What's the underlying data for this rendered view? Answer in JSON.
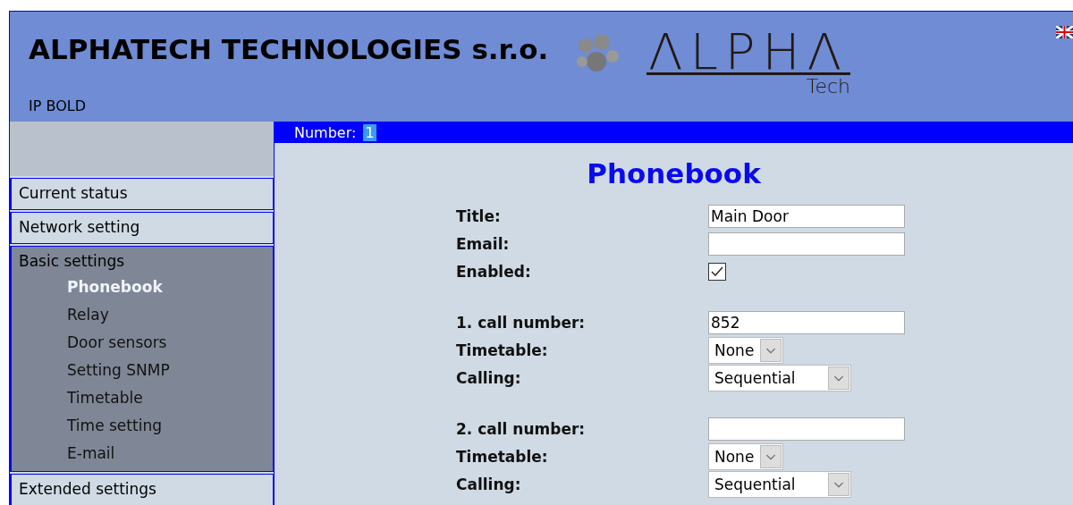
{
  "header": {
    "company": "ALPHATECH TECHNOLOGIES s.r.o.",
    "logo_text": "ΛLPHΛ",
    "logo_sub": "Tech",
    "device": "IP BOLD"
  },
  "number_bar": {
    "label": "Number:",
    "value": "1"
  },
  "sidebar": {
    "items": [
      {
        "label": "Current status",
        "expanded": false
      },
      {
        "label": "Network setting",
        "expanded": false
      },
      {
        "label": "Basic settings",
        "expanded": true,
        "children": [
          {
            "label": "Phonebook",
            "selected": true
          },
          {
            "label": "Relay",
            "selected": false
          },
          {
            "label": "Door sensors",
            "selected": false
          },
          {
            "label": "Setting SNMP",
            "selected": false
          },
          {
            "label": "Timetable",
            "selected": false
          },
          {
            "label": "Time setting",
            "selected": false
          },
          {
            "label": "E-mail",
            "selected": false
          }
        ]
      },
      {
        "label": "Extended settings",
        "expanded": false
      }
    ]
  },
  "page_title": "Phonebook",
  "sections": [
    [
      {
        "kind": "text",
        "label": "Title:",
        "value": "Main Door"
      },
      {
        "kind": "text",
        "label": "Email:"
      },
      {
        "kind": "checkbox",
        "label": "Enabled:",
        "checked": true
      }
    ],
    [
      {
        "kind": "text",
        "label": "1. call number:",
        "value": "852"
      },
      {
        "kind": "select",
        "label": "Timetable:",
        "value": "None"
      },
      {
        "kind": "combo",
        "label": "Calling:",
        "value": "Sequential"
      }
    ],
    [
      {
        "kind": "text",
        "label": "2. call number:"
      },
      {
        "kind": "select",
        "label": "Timetable:",
        "value": "None"
      },
      {
        "kind": "combo",
        "label": "Calling:",
        "value": "Sequential"
      }
    ]
  ]
}
